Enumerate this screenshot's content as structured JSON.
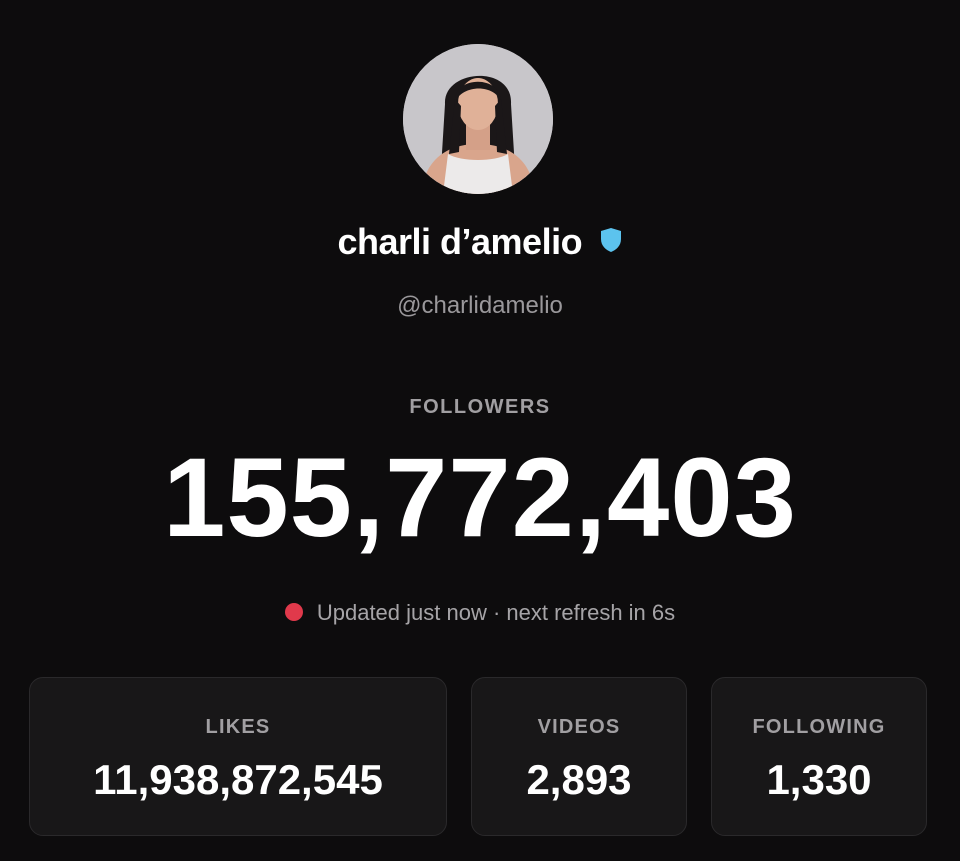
{
  "profile": {
    "display_name": "charli d’amelio",
    "handle": "@charlidamelio",
    "verified_color": "#5cc3ee"
  },
  "followers": {
    "label": "FOLLOWERS",
    "count": "155,772,403"
  },
  "status": {
    "text": "Updated just now · next refresh in 6s",
    "dot_color": "#e0394b"
  },
  "stats": [
    {
      "label": "LIKES",
      "value": "11,938,872,545"
    },
    {
      "label": "VIDEOS",
      "value": "2,893"
    },
    {
      "label": "FOLLOWING",
      "value": "1,330"
    }
  ],
  "icons": {
    "verified": "verified-shield-icon",
    "status": "live-status-dot"
  }
}
